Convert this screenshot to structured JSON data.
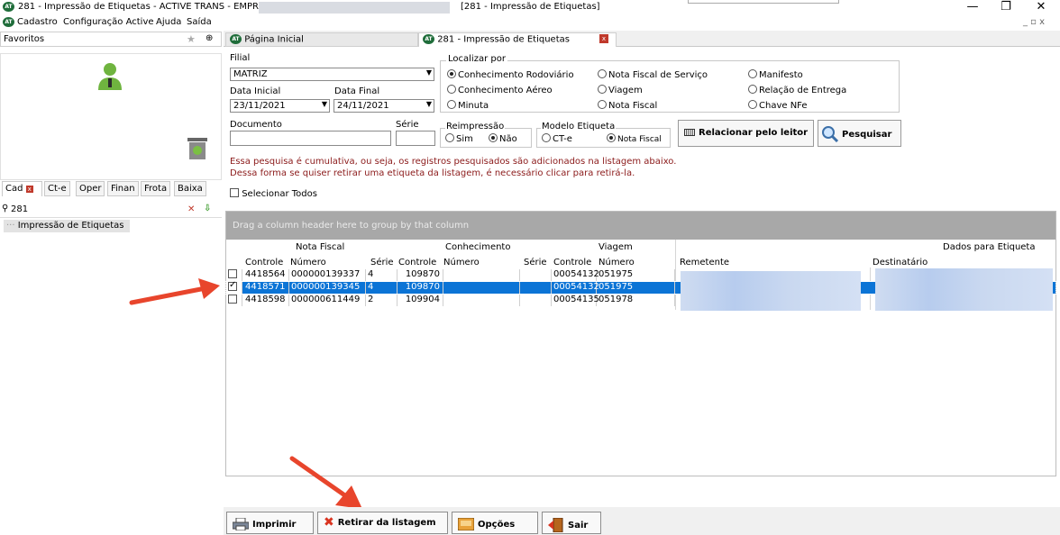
{
  "window": {
    "title": "281 - Impressão de Etiquetas - ACTIVE TRANS - EMPRESA:",
    "title_tab": "[281 - Impressão de Etiquetas]",
    "minimize": "—",
    "maximize": "❐",
    "close": "✕"
  },
  "menu": [
    "Cadastro",
    "Configuração Active",
    "Ajuda",
    "Saída"
  ],
  "mdi_controls": "_ ▫ x",
  "logo_text": "AT",
  "favorites": {
    "label": "Favoritos",
    "star": "★",
    "pin": "⊕"
  },
  "left_tabs": [
    "Cad",
    "Ct-e",
    "Oper",
    "Finan",
    "Frota",
    "Baixa"
  ],
  "left_search": {
    "value": "281",
    "clear": "✕",
    "go": "⇩"
  },
  "tree": {
    "item": "Impressão de Etiquetas"
  },
  "doc_tabs": {
    "home": "Página Inicial",
    "active": "281 - Impressão de Etiquetas",
    "close": "x"
  },
  "form": {
    "filial_label": "Filial",
    "filial_value": "MATRIZ",
    "data_inicial_label": "Data Inicial",
    "data_inicial_value": "23/11/2021",
    "data_final_label": "Data Final",
    "data_final_value": "24/11/2021",
    "documento_label": "Documento",
    "serie_label": "Série",
    "localizar_label": "Localizar por",
    "localizar_options": [
      {
        "label": "Conhecimento Rodoviário",
        "checked": true
      },
      {
        "label": "Conhecimento Aéreo",
        "checked": false
      },
      {
        "label": "Minuta",
        "checked": false
      },
      {
        "label": "Nota Fiscal de Serviço",
        "checked": false
      },
      {
        "label": "Viagem",
        "checked": false
      },
      {
        "label": "Nota Fiscal",
        "checked": false
      },
      {
        "label": "Manifesto",
        "checked": false
      },
      {
        "label": "Relação de Entrega",
        "checked": false
      },
      {
        "label": "Chave NFe",
        "checked": false
      }
    ],
    "reimpressao_label": "Reimpressão",
    "reimpressao_sim": "Sim",
    "reimpressao_nao": "Não",
    "modelo_label": "Modelo Etiqueta",
    "modelo_cte": "CT-e",
    "modelo_nf": "Nota Fiscal",
    "btn_relacionar": "Relacionar pelo leitor",
    "btn_pesquisar": "Pesquisar",
    "info_line1": "Essa pesquisa é cumulativa, ou seja, os registros pesquisados são adicionados na listagem abaixo.",
    "info_line2": "Dessa forma se quiser retirar uma etiqueta da listagem, é necessário clicar para retirá-la.",
    "select_all": "Selecionar Todos"
  },
  "grid": {
    "group_hint": "Drag a column header here to group by that column",
    "bands": {
      "nota_fiscal": "Nota Fiscal",
      "conhecimento": "Conhecimento",
      "viagem": "Viagem",
      "dados": "Dados para Etiqueta"
    },
    "columns": {
      "nf_controle": "Controle",
      "nf_numero": "Número",
      "nf_serie": "Série",
      "ct_controle": "Controle",
      "ct_numero": "Número",
      "ct_serie": "Série",
      "vg_controle": "Controle",
      "vg_numero": "Número",
      "remetente": "Remetente",
      "destinatario": "Destinatário"
    },
    "rows": [
      {
        "checked": false,
        "nf_controle": "4418564",
        "nf_numero": "000000139337",
        "nf_serie": "4",
        "ct_controle": "109870",
        "vg_controle": "00054132",
        "vg_numero": "051975",
        "selected": false
      },
      {
        "checked": true,
        "nf_controle": "4418571",
        "nf_numero": "000000139345",
        "nf_serie": "4",
        "ct_controle": "109870",
        "vg_controle": "00054132",
        "vg_numero": "051975",
        "selected": true
      },
      {
        "checked": false,
        "nf_controle": "4418598",
        "nf_numero": "000000611449",
        "nf_serie": "2",
        "ct_controle": "109904",
        "vg_controle": "00054135",
        "vg_numero": "051978",
        "selected": false
      }
    ]
  },
  "bottom": {
    "imprimir": "Imprimir",
    "retirar": "Retirar da listagem",
    "opcoes": "Opções",
    "sair": "Sair"
  },
  "colors": {
    "selection": "#0b74d6",
    "info_text": "#8b1a1a",
    "arrow": "#e8452c",
    "group_bar": "#a8a8a8"
  }
}
